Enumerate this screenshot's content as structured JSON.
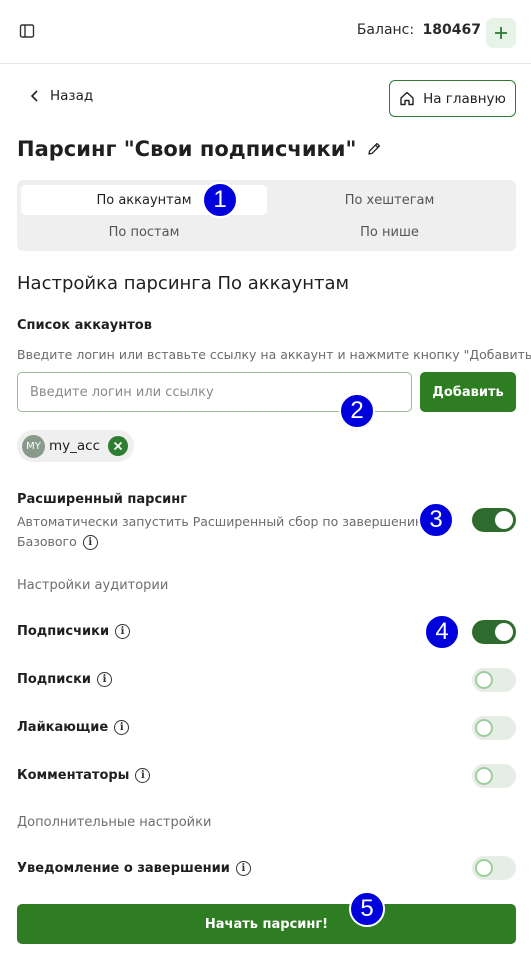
{
  "topbar": {
    "balance_label": "Баланс:",
    "balance_value": "180467",
    "icons": {
      "sidebar": "sidebar-toggle-icon",
      "add": "plus-icon"
    }
  },
  "nav": {
    "back_label": "Назад",
    "home_label": "На главную"
  },
  "page": {
    "title": "Парсинг \"Свои подписчики\""
  },
  "tabs": [
    {
      "label": "По аккаунтам",
      "active": true
    },
    {
      "label": "По хештегам",
      "active": false
    },
    {
      "label": "По постам",
      "active": false
    },
    {
      "label": "По нише",
      "active": false
    }
  ],
  "settings": {
    "title": "Настройка парсинга По аккаунтам",
    "accounts_label": "Список аккаунтов",
    "accounts_help": "Введите логин или вставьте ссылку на аккаунт и нажмите кнопку \"Добавить\"",
    "input_placeholder": "Введите логин или ссылку",
    "input_value": "",
    "add_label": "Добавить",
    "chips": [
      {
        "avatar": "MY",
        "text": "my_acc"
      }
    ],
    "extended_label": "Расширенный парсинг",
    "extended_help_line1": "Автоматически запустить Расширенный сбор по завершению",
    "extended_help_line2": "Базового",
    "extended_on": true,
    "audience_heading": "Настройки аудитории",
    "audience": [
      {
        "label": "Подписчики",
        "on": true
      },
      {
        "label": "Подписки",
        "on": false
      },
      {
        "label": "Лайкающие",
        "on": false
      },
      {
        "label": "Комментаторы",
        "on": false
      }
    ],
    "extra_heading": "Дополнительные настройки",
    "notify_label": "Уведомление о завершении",
    "notify_on": false,
    "start_label": "Начать парсинг!"
  },
  "markers": [
    "1",
    "2",
    "3",
    "4",
    "5"
  ],
  "colors": {
    "accent": "#2e7d22",
    "toggle_on": "#2e6b2e",
    "marker": "#0000dd"
  }
}
